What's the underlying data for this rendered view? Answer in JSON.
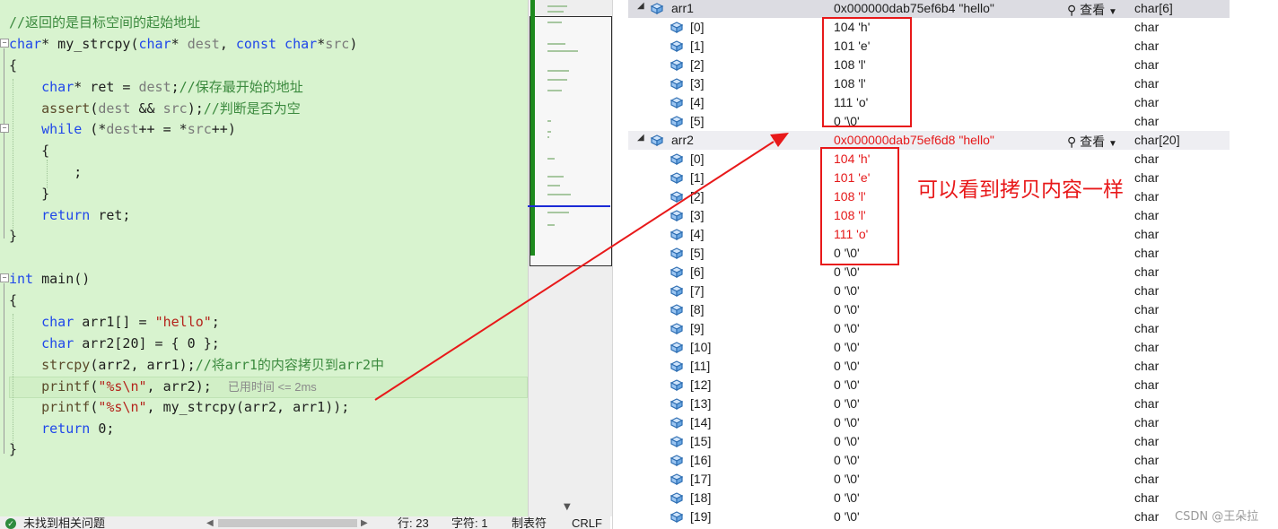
{
  "editor": {
    "lines": [
      {
        "parts": [
          {
            "c": "cm",
            "t": "//返回的是目标空间的起始地址"
          }
        ]
      },
      {
        "parts": [
          {
            "c": "kw",
            "t": "char"
          },
          {
            "c": "",
            "t": "* my_strcpy("
          },
          {
            "c": "kw",
            "t": "char"
          },
          {
            "c": "",
            "t": "* "
          },
          {
            "c": "pm",
            "t": "dest"
          },
          {
            "c": "",
            "t": ", "
          },
          {
            "c": "kw",
            "t": "const char"
          },
          {
            "c": "",
            "t": "*"
          },
          {
            "c": "pm",
            "t": "src"
          },
          {
            "c": "",
            "t": ")"
          }
        ]
      },
      {
        "parts": [
          {
            "c": "",
            "t": "{"
          }
        ]
      },
      {
        "parts": [
          {
            "c": "",
            "t": "    "
          },
          {
            "c": "kw",
            "t": "char"
          },
          {
            "c": "",
            "t": "* ret = "
          },
          {
            "c": "pm",
            "t": "dest"
          },
          {
            "c": "",
            "t": ";"
          },
          {
            "c": "cm",
            "t": "//保存最开始的地址"
          }
        ]
      },
      {
        "parts": [
          {
            "c": "",
            "t": "    "
          },
          {
            "c": "fn",
            "t": "assert"
          },
          {
            "c": "",
            "t": "("
          },
          {
            "c": "pm",
            "t": "dest"
          },
          {
            "c": "",
            "t": " && "
          },
          {
            "c": "pm",
            "t": "src"
          },
          {
            "c": "",
            "t": ");"
          },
          {
            "c": "cm",
            "t": "//判断是否为空"
          }
        ]
      },
      {
        "parts": [
          {
            "c": "",
            "t": "    "
          },
          {
            "c": "kw",
            "t": "while"
          },
          {
            "c": "",
            "t": " (*"
          },
          {
            "c": "pm",
            "t": "dest"
          },
          {
            "c": "",
            "t": "++ = *"
          },
          {
            "c": "pm",
            "t": "src"
          },
          {
            "c": "",
            "t": "++)"
          }
        ]
      },
      {
        "parts": [
          {
            "c": "",
            "t": "    {"
          }
        ]
      },
      {
        "parts": [
          {
            "c": "",
            "t": "        ;"
          }
        ]
      },
      {
        "parts": [
          {
            "c": "",
            "t": "    }"
          }
        ]
      },
      {
        "parts": [
          {
            "c": "",
            "t": "    "
          },
          {
            "c": "kw",
            "t": "return"
          },
          {
            "c": "",
            "t": " ret;"
          }
        ]
      },
      {
        "parts": [
          {
            "c": "",
            "t": "}"
          }
        ]
      },
      {
        "parts": []
      },
      {
        "parts": [
          {
            "c": "kw",
            "t": "int"
          },
          {
            "c": "",
            "t": " main()"
          }
        ]
      },
      {
        "parts": [
          {
            "c": "",
            "t": "{"
          }
        ]
      },
      {
        "parts": [
          {
            "c": "",
            "t": "    "
          },
          {
            "c": "kw",
            "t": "char"
          },
          {
            "c": "",
            "t": " arr1[] = "
          },
          {
            "c": "st",
            "t": "\"hello\""
          },
          {
            "c": "",
            "t": ";"
          }
        ]
      },
      {
        "parts": [
          {
            "c": "",
            "t": "    "
          },
          {
            "c": "kw",
            "t": "char"
          },
          {
            "c": "",
            "t": " arr2[20] = { 0 };"
          }
        ]
      },
      {
        "parts": [
          {
            "c": "",
            "t": "    "
          },
          {
            "c": "fn",
            "t": "strcpy"
          },
          {
            "c": "",
            "t": "(arr2, arr1);"
          },
          {
            "c": "cm",
            "t": "//将arr1的内容拷贝到arr2中"
          }
        ]
      },
      {
        "parts": [
          {
            "c": "",
            "t": "    "
          },
          {
            "c": "fn",
            "t": "printf"
          },
          {
            "c": "",
            "t": "("
          },
          {
            "c": "st",
            "t": "\"%s"
          },
          {
            "c": "es",
            "t": "\\n"
          },
          {
            "c": "st",
            "t": "\""
          },
          {
            "c": "",
            "t": ", arr2);  "
          },
          {
            "c": "hint",
            "t": "已用时间 <= 2ms"
          }
        ]
      },
      {
        "parts": [
          {
            "c": "",
            "t": "    "
          },
          {
            "c": "fn",
            "t": "printf"
          },
          {
            "c": "",
            "t": "("
          },
          {
            "c": "st",
            "t": "\"%s"
          },
          {
            "c": "es",
            "t": "\\n"
          },
          {
            "c": "st",
            "t": "\""
          },
          {
            "c": "",
            "t": ", my_strcpy(arr2, arr1));"
          }
        ]
      },
      {
        "parts": [
          {
            "c": "",
            "t": "    "
          },
          {
            "c": "kw",
            "t": "return"
          },
          {
            "c": "",
            "t": " 0;"
          }
        ]
      },
      {
        "parts": [
          {
            "c": "",
            "t": "}"
          }
        ]
      }
    ]
  },
  "statusbar": {
    "issues": "未找到相关问题",
    "line": "行: 23",
    "char": "字符: 1",
    "tabs": "制表符",
    "eol": "CRLF"
  },
  "watch": {
    "view_label": "查看",
    "arr1": {
      "name": "arr1",
      "value": "0x000000dab75ef6b4 \"hello\"",
      "type": "char[6]",
      "items": [
        {
          "i": "[0]",
          "v": "104 'h'",
          "t": "char"
        },
        {
          "i": "[1]",
          "v": "101 'e'",
          "t": "char"
        },
        {
          "i": "[2]",
          "v": "108 'l'",
          "t": "char"
        },
        {
          "i": "[3]",
          "v": "108 'l'",
          "t": "char"
        },
        {
          "i": "[4]",
          "v": "111 'o'",
          "t": "char"
        },
        {
          "i": "[5]",
          "v": "0 '\\0'",
          "t": "char"
        }
      ]
    },
    "arr2": {
      "name": "arr2",
      "value": "0x000000dab75ef6d8 \"hello\"",
      "type": "char[20]",
      "items": [
        {
          "i": "[0]",
          "v": "104 'h'",
          "t": "char",
          "changed": true
        },
        {
          "i": "[1]",
          "v": "101 'e'",
          "t": "char",
          "changed": true
        },
        {
          "i": "[2]",
          "v": "108 'l'",
          "t": "char",
          "changed": true
        },
        {
          "i": "[3]",
          "v": "108 'l'",
          "t": "char",
          "changed": true
        },
        {
          "i": "[4]",
          "v": "111 'o'",
          "t": "char",
          "changed": true
        },
        {
          "i": "[5]",
          "v": "0 '\\0'",
          "t": "char"
        },
        {
          "i": "[6]",
          "v": "0 '\\0'",
          "t": "char"
        },
        {
          "i": "[7]",
          "v": "0 '\\0'",
          "t": "char"
        },
        {
          "i": "[8]",
          "v": "0 '\\0'",
          "t": "char"
        },
        {
          "i": "[9]",
          "v": "0 '\\0'",
          "t": "char"
        },
        {
          "i": "[10]",
          "v": "0 '\\0'",
          "t": "char"
        },
        {
          "i": "[11]",
          "v": "0 '\\0'",
          "t": "char"
        },
        {
          "i": "[12]",
          "v": "0 '\\0'",
          "t": "char"
        },
        {
          "i": "[13]",
          "v": "0 '\\0'",
          "t": "char"
        },
        {
          "i": "[14]",
          "v": "0 '\\0'",
          "t": "char"
        },
        {
          "i": "[15]",
          "v": "0 '\\0'",
          "t": "char"
        },
        {
          "i": "[16]",
          "v": "0 '\\0'",
          "t": "char"
        },
        {
          "i": "[17]",
          "v": "0 '\\0'",
          "t": "char"
        },
        {
          "i": "[18]",
          "v": "0 '\\0'",
          "t": "char"
        },
        {
          "i": "[19]",
          "v": "0 '\\0'",
          "t": "char"
        }
      ]
    }
  },
  "annotation": "可以看到拷贝内容一样",
  "watermark": "CSDN @王朵拉",
  "colors": {
    "changed_value": "#e5191a",
    "keyword": "#1f47ea",
    "comment": "#3b8a3e",
    "string": "#b4231b",
    "editor_bg": "#d8f3cf"
  },
  "icons": [
    "fold-minus-icon",
    "expand-triangle-icon",
    "variable-cube-icon",
    "magnifier-icon",
    "dropdown-caret-icon",
    "check-circle-icon",
    "scroll-down-icon"
  ]
}
